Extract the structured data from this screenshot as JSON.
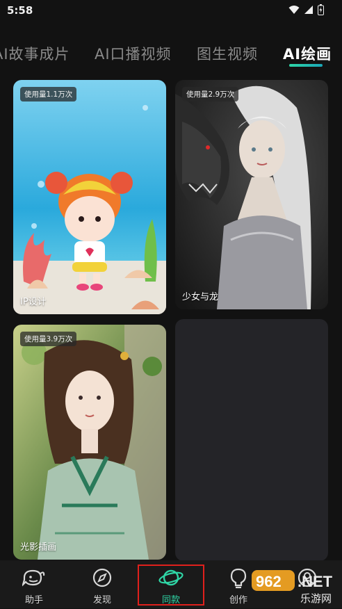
{
  "status_bar": {
    "time": "5:58"
  },
  "tabs": [
    {
      "label": "AI故事成片",
      "active": false
    },
    {
      "label": "AI口播视频",
      "active": false
    },
    {
      "label": "图生视频",
      "active": false
    },
    {
      "label": "AI绘画",
      "active": true
    }
  ],
  "cards": [
    {
      "usage": "使用量1.1万次",
      "title": "IP设计"
    },
    {
      "usage": "使用量2.9万次",
      "title": "少女与龙"
    },
    {
      "usage": "使用量3.9万次",
      "title": "光影插画"
    }
  ],
  "nav": {
    "items": [
      {
        "label": "助手",
        "icon": "whale-icon"
      },
      {
        "label": "发现",
        "icon": "compass-icon"
      },
      {
        "label": "同款",
        "icon": "planet-icon",
        "active": true
      },
      {
        "label": "创作",
        "icon": "bulb-icon"
      },
      {
        "label": "",
        "icon": "user-icon"
      }
    ]
  },
  "watermark": {
    "brand": "962.NET",
    "sub": "乐游网"
  },
  "colors": {
    "accent": "#2fd6a6",
    "highlight": "#e0201c",
    "background": "#121212"
  }
}
